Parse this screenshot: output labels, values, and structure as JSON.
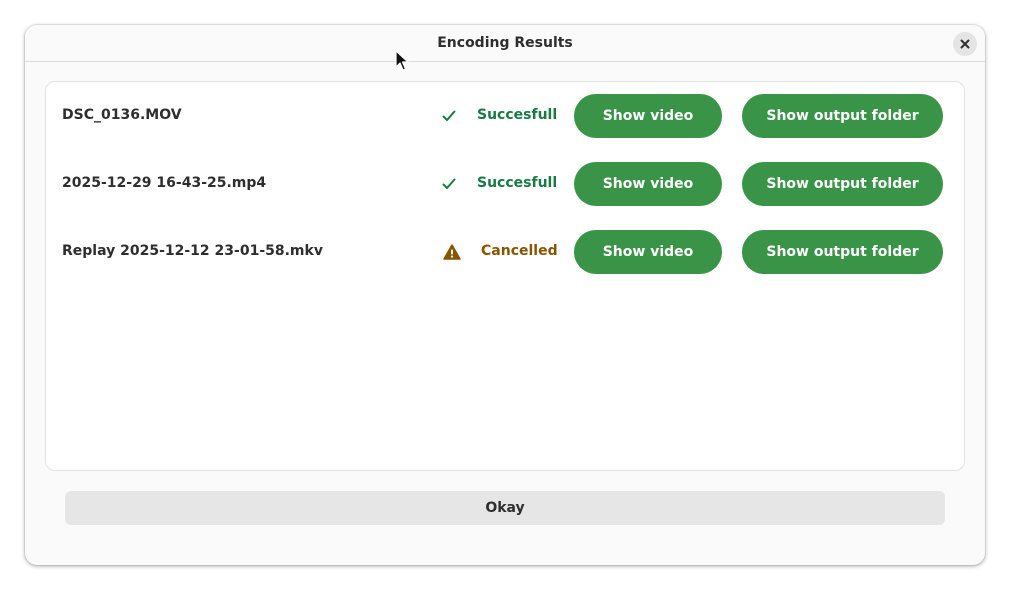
{
  "dialog": {
    "title": "Encoding Results",
    "close_icon": "close-icon",
    "okay_label": "Okay"
  },
  "results": [
    {
      "filename": "DSC_0136.MOV",
      "status": "Succesfull",
      "status_kind": "success",
      "status_icon": "check-icon",
      "show_video_label": "Show video",
      "show_folder_label": "Show output folder"
    },
    {
      "filename": "2025-12-29 16-43-25.mp4",
      "status": "Succesfull",
      "status_kind": "success",
      "status_icon": "check-icon",
      "show_video_label": "Show video",
      "show_folder_label": "Show output folder"
    },
    {
      "filename": "Replay 2025-12-12 23-01-58.mkv",
      "status": "Cancelled",
      "status_kind": "warning",
      "status_icon": "warning-icon",
      "show_video_label": "Show video",
      "show_folder_label": "Show output folder"
    }
  ],
  "colors": {
    "button_green": "#3a9448",
    "success_text": "#1a7a45",
    "warning_text": "#8a5300",
    "warning_icon": "#8a5300",
    "okay_background": "#e6e6e6"
  }
}
